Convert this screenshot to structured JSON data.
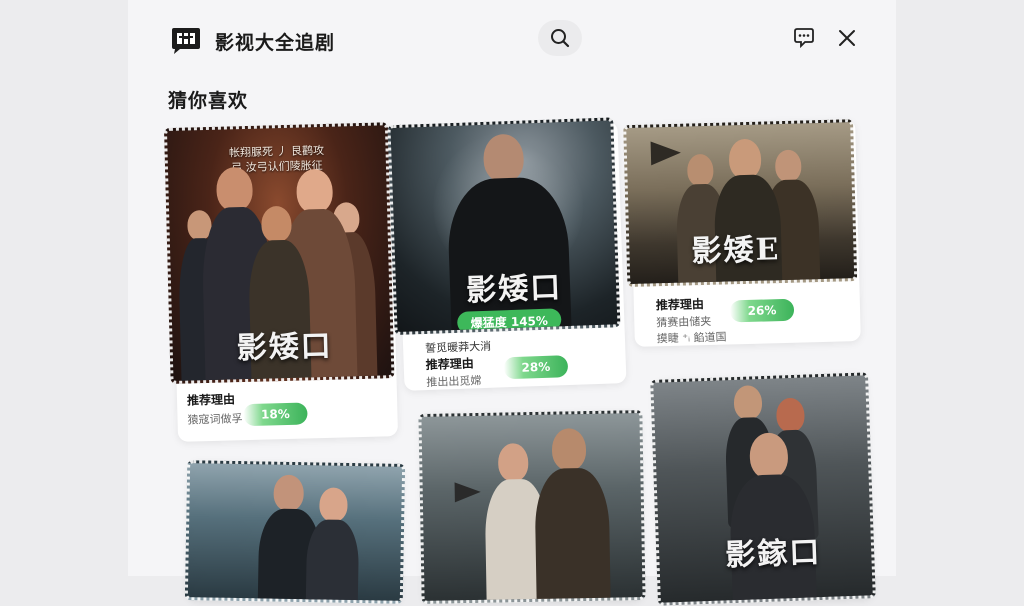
{
  "header": {
    "logo_icon": "tv-chat-logo-icon",
    "title": "影视大全追剧",
    "search_icon": "search-icon",
    "message_icon": "message-icon",
    "close_icon": "close-icon"
  },
  "section": {
    "title": "猜你喜欢"
  },
  "cards": [
    {
      "poster_title": "影矮口",
      "poster_tagline_1": "帐翔脲死 丿 艮鹳攻",
      "poster_tagline_2": "弓 汝弓认们陵胀征",
      "reason_label": "推荐理由",
      "reason_text": "猿寇词做孚",
      "match": "18%"
    },
    {
      "poster_title": "影矮口",
      "overlay_pill": "爆猛度 145%",
      "reason_top": "誓觅暖莽大消",
      "reason_label": "推荐理由",
      "reason_text": "推出出觅嫦",
      "match": "28%"
    },
    {
      "poster_title": "影矮E",
      "reason_label": "推荐理由",
      "reason_text_1": "猜赛由储夹",
      "reason_text_2": "摸睫 ⁺ᵢ 餡道国",
      "match": "26%"
    },
    {
      "poster_title": ""
    },
    {
      "poster_title": ""
    },
    {
      "poster_title": "影鎵口"
    }
  ],
  "colors": {
    "match_green": "#3cb35a",
    "background": "#f5f5f7"
  }
}
